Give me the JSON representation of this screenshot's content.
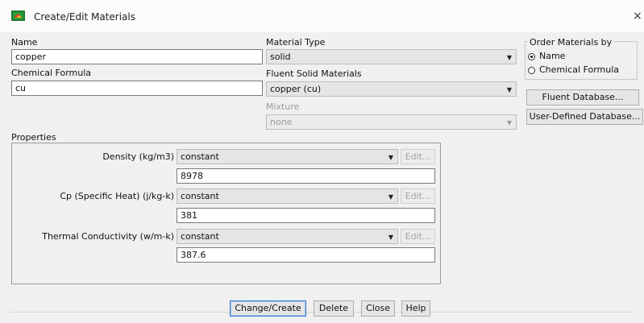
{
  "window": {
    "title": "Create/Edit Materials",
    "close_glyph": "×",
    "icon": "fluent-app-icon"
  },
  "left": {
    "name_label": "Name",
    "name_value": "copper",
    "formula_label": "Chemical Formula",
    "formula_value": "cu"
  },
  "middle": {
    "material_type_label": "Material Type",
    "material_type_value": "solid",
    "fluent_solid_label": "Fluent Solid Materials",
    "fluent_solid_value": "copper (cu)",
    "mixture_label": "Mixture",
    "mixture_value": "none"
  },
  "order": {
    "label": "Order Materials by",
    "options": [
      "Name",
      "Chemical Formula"
    ],
    "selected": "Name"
  },
  "database_buttons": {
    "fluent_db": "Fluent Database...",
    "user_db": "User-Defined Database..."
  },
  "properties": {
    "label": "Properties",
    "rows": [
      {
        "label": "Density (kg/m3)",
        "method": "constant",
        "edit": "Edit...",
        "value": "8978"
      },
      {
        "label": "Cp (Specific Heat) (j/kg-k)",
        "method": "constant",
        "edit": "Edit...",
        "value": "381"
      },
      {
        "label": "Thermal Conductivity (w/m-k)",
        "method": "constant",
        "edit": "Edit...",
        "value": "387.6"
      }
    ]
  },
  "actions": {
    "change_create": "Change/Create",
    "delete": "Delete",
    "close": "Close",
    "help": "Help"
  },
  "colors": {
    "dialog_bg": "#f0f0f0",
    "title_bg": "#fbfbfb",
    "combo_bg": "#e5e5e5",
    "default_button_border": "#3b7bd0"
  }
}
